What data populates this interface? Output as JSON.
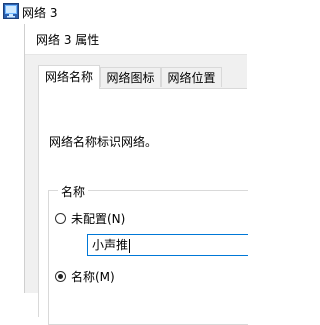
{
  "outer_window": {
    "title": "网络 3"
  },
  "dialog": {
    "title": "网络 3 属性"
  },
  "tabs": [
    {
      "label": "网络名称",
      "active": true
    },
    {
      "label": "网络图标",
      "active": false
    },
    {
      "label": "网络位置",
      "active": false
    }
  ],
  "panel": {
    "description": "网络名称标识网络。",
    "group_label": "名称",
    "options": [
      {
        "label": "未配置(N)",
        "checked": false
      },
      {
        "label": "名称(M)",
        "checked": true
      }
    ],
    "name_input": {
      "value": "小声推"
    }
  },
  "colors": {
    "focus_border": "#0078d7",
    "dialog_bg": "#f0f0f0"
  },
  "icons": {
    "app": "network-icon"
  }
}
